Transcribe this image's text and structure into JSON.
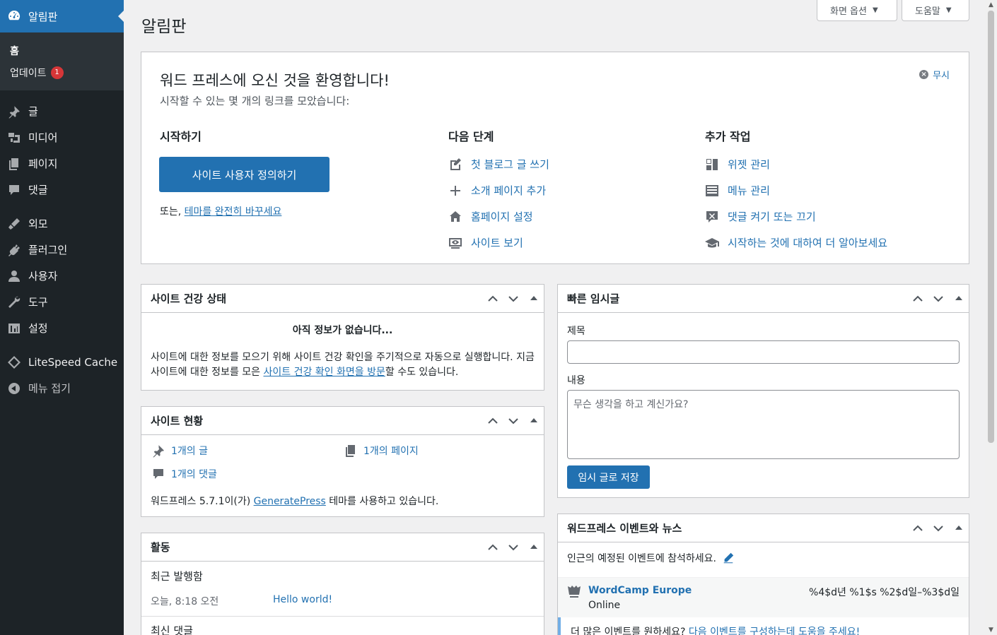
{
  "sidebar": {
    "dashboard_label": "알림판",
    "sub_items": [
      {
        "label": "홈"
      },
      {
        "label": "업데이트",
        "badge": "1"
      }
    ],
    "items": [
      {
        "label": "글",
        "icon": "pin-icon"
      },
      {
        "label": "미디어",
        "icon": "media-icon"
      },
      {
        "label": "페이지",
        "icon": "pages-icon"
      },
      {
        "label": "댓글",
        "icon": "comments-icon"
      },
      {
        "label": "외모",
        "icon": "appearance-icon"
      },
      {
        "label": "플러그인",
        "icon": "plugins-icon"
      },
      {
        "label": "사용자",
        "icon": "users-icon"
      },
      {
        "label": "도구",
        "icon": "tools-icon"
      },
      {
        "label": "설정",
        "icon": "settings-icon"
      },
      {
        "label": "LiteSpeed Cache",
        "icon": "litespeed-icon"
      },
      {
        "label": "메뉴 접기",
        "icon": "collapse-icon"
      }
    ]
  },
  "header": {
    "title": "알림판",
    "screen_options": "화면 옵션",
    "help": "도움말"
  },
  "welcome": {
    "title": "워드 프레스에 오신 것을 환영합니다!",
    "about": "시작할 수 있는 몇 개의 링크를 모았습니다:",
    "dismiss": "무시",
    "col1": {
      "heading": "시작하기",
      "button": "사이트 사용자 정의하기",
      "or_text": "또는, ",
      "or_link": "테마를 완전히 바꾸세요"
    },
    "col2": {
      "heading": "다음 단계",
      "links": [
        "첫 블로그 글 쓰기",
        "소개 페이지 추가",
        "홈페이지 설정",
        "사이트 보기"
      ]
    },
    "col3": {
      "heading": "추가 작업",
      "links": [
        "위젯 관리",
        "메뉴 관리",
        "댓글 켜기 또는 끄기",
        "시작하는 것에 대하여 더 알아보세요"
      ]
    }
  },
  "site_health": {
    "title": "사이트 건강 상태",
    "no_info": "아직 정보가 없습니다...",
    "desc_before": "사이트에 대한 정보를 모으기 위해 사이트 건강 확인을 주기적으로 자동으로 실행합니다. 지금 사이트에 대한 정보를 모은 ",
    "desc_link": "사이트 건강 확인 화면을 방문",
    "desc_after": "할 수도 있습니다."
  },
  "at_a_glance": {
    "title": "사이트 현황",
    "posts": "1개의 글",
    "pages": "1개의 페이지",
    "comments": "1개의 댓글",
    "version_before": "워드프레스 5.7.1이(가) ",
    "theme_link": "GeneratePress",
    "version_after": " 테마를 사용하고 있습니다."
  },
  "activity": {
    "title": "활동",
    "recent_published": "최근 발행함",
    "row_time": "오늘, 8:18 오전",
    "row_link": "Hello world!",
    "recent_comments": "최신 댓글"
  },
  "quick_draft": {
    "title": "빠른 임시글",
    "title_label": "제목",
    "title_value": "",
    "content_label": "내용",
    "content_placeholder": "무슨 생각을 하고 계신가요?",
    "save_button": "임시 글로 저장"
  },
  "events": {
    "title": "워드프레스 이벤트와 뉴스",
    "intro": "인근의 예정된 이벤트에 참석하세요.",
    "event_title": "WordCamp Europe",
    "event_location": "Online",
    "event_date": "%4$d년 %1$s %2$d일–%3$d일",
    "more_text": "더 많은 이벤트를 원하세요? ",
    "more_link": "다음 이벤트를 구성하는데 도움을 주세요!"
  },
  "colors": {
    "sidebar_bg": "#1d2327",
    "accent": "#2271b1",
    "badge": "#d63638"
  }
}
